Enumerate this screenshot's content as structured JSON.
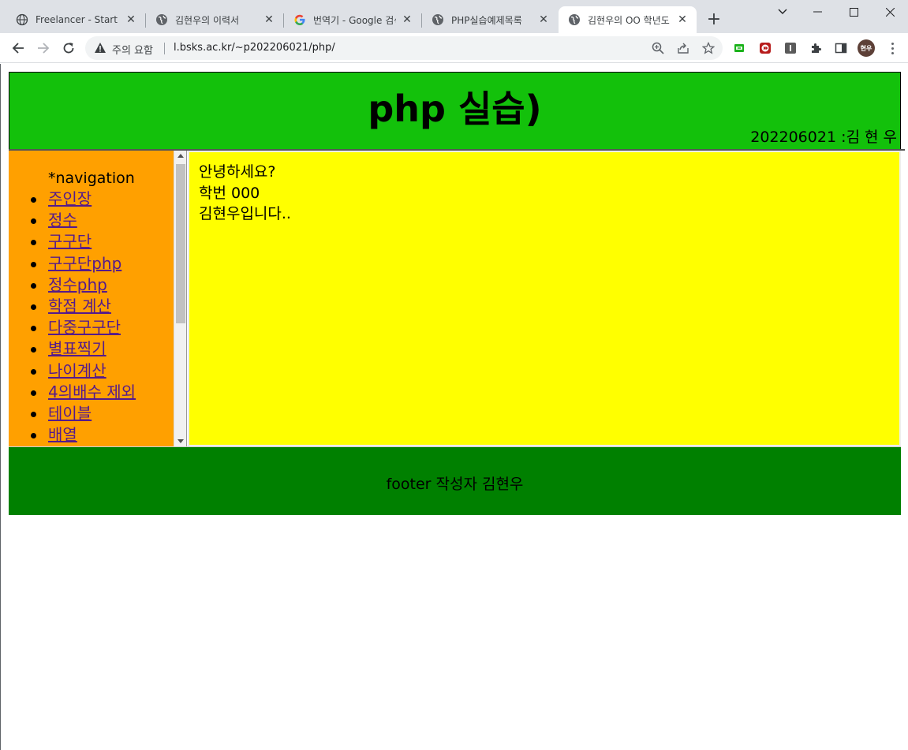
{
  "browser": {
    "tabs": [
      {
        "title": "Freelancer - Start Bo",
        "icon": "globe-icon",
        "active": false
      },
      {
        "title": "김현우의 이력서",
        "icon": "site-globe-icon",
        "active": false
      },
      {
        "title": "번역기 - Google 검색",
        "icon": "google-icon",
        "active": false
      },
      {
        "title": "PHP실습예제목록",
        "icon": "site-globe-icon",
        "active": false
      },
      {
        "title": "김현우의 OO 학년도",
        "icon": "site-globe-icon",
        "active": true
      }
    ],
    "new_tab_label": "+",
    "security_label": "주의 요함",
    "url": "l.bsks.ac.kr/~p202206021/php/",
    "profile_label": "현우"
  },
  "page": {
    "header": {
      "title": "php 실습)",
      "subtitle": "202206021 :김 현 우"
    },
    "nav": {
      "heading": "*navigation",
      "items": [
        "주인장",
        "정수",
        "구구단",
        "구구단php",
        "정수php",
        "학점 계산",
        "다중구구단",
        "별표찍기",
        "나이계산",
        "4의배수 제외",
        "테이블",
        "배열"
      ]
    },
    "main": {
      "lines": [
        "안녕하세요?",
        "학번 000",
        "김현우입니다.."
      ]
    },
    "footer": {
      "text": "footer 작성자 김현우"
    },
    "colors": {
      "header_bg": "#13c10b",
      "nav_bg": "#ffa000",
      "main_bg": "#ffff00",
      "footer_bg": "#008000",
      "link": "#551a8b"
    }
  }
}
